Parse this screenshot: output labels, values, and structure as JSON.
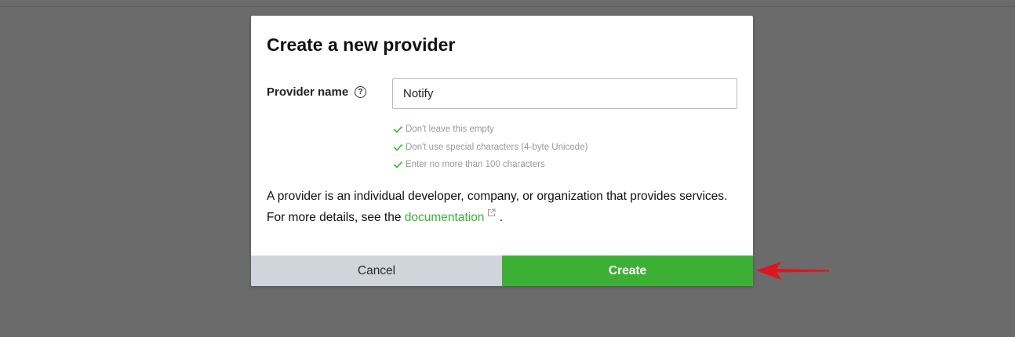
{
  "dialog": {
    "title": "Create a new provider",
    "field_label": "Provider name",
    "help_icon_glyph": "?",
    "input_value": "Notify",
    "validation_rules": [
      "Don't leave this empty",
      "Don't use special characters (4-byte Unicode)",
      "Enter no more than 100 characters"
    ],
    "description_prefix": "A provider is an individual developer, company, or organization that provides services. For more details, see the ",
    "link_text": "documentation",
    "description_suffix": " .",
    "cancel_label": "Cancel",
    "create_label": "Create"
  },
  "icons": {
    "help": "question-circle-icon",
    "rule_status": "check-icon",
    "link": "external-link-icon",
    "annotation": "red-arrow-pointing-left"
  },
  "colors": {
    "backdrop": "#6b6b6b",
    "accent_green": "#3cb034",
    "cancel_bg": "#d0d5dc",
    "arrow_red": "#e0141e",
    "rule_text": "#9a9a9a"
  }
}
